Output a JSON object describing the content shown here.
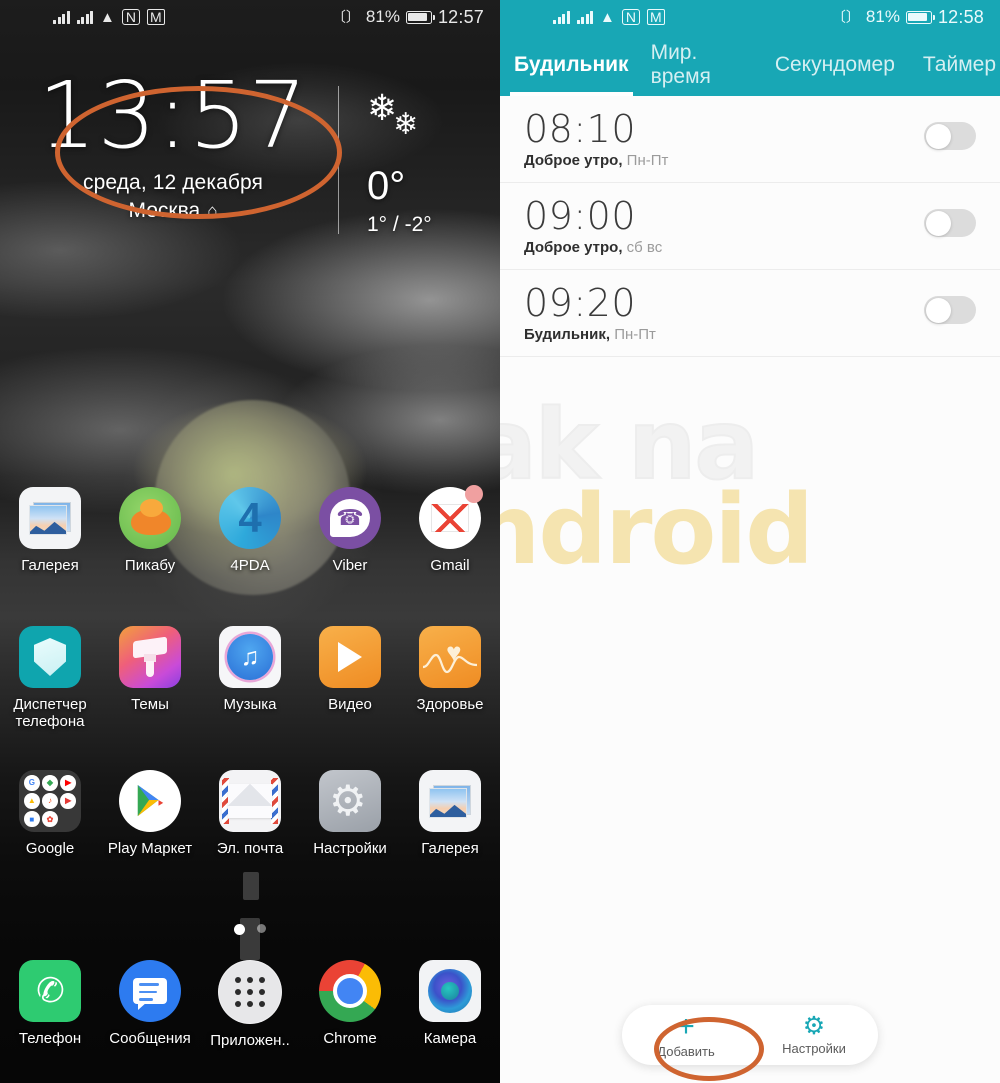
{
  "left_phone": {
    "status_bar": {
      "signal_1": "signal-bars-icon",
      "signal_2": "signal-bars-icon",
      "wifi": "wifi-icon",
      "nfc": "nfc-icon",
      "gmail": "gmail-notification-icon",
      "vibrate": "vibrate-icon",
      "battery_percent": "81%",
      "battery": "battery-icon",
      "time": "12:57"
    },
    "clock_widget": {
      "time": "13:57",
      "date": "среда, 12 декабря",
      "city": "Москва",
      "home_icon": "home-icon",
      "weather_icon": "snowflake-icon",
      "temp": "0°",
      "temp_range": "1° / -2°"
    },
    "apps": [
      [
        {
          "label": "Галерея",
          "icon": "gallery-icon"
        },
        {
          "label": "Пикабу",
          "icon": "pikabu-icon"
        },
        {
          "label": "4PDA",
          "icon": "4pda-icon"
        },
        {
          "label": "Viber",
          "icon": "viber-icon"
        },
        {
          "label": "Gmail",
          "icon": "gmail-icon"
        }
      ],
      [
        {
          "label": "Диспетчер\nтелефона",
          "icon": "phone-manager-icon"
        },
        {
          "label": "Темы",
          "icon": "themes-icon"
        },
        {
          "label": "Музыка",
          "icon": "music-icon"
        },
        {
          "label": "Видео",
          "icon": "video-icon"
        },
        {
          "label": "Здоровье",
          "icon": "health-icon"
        }
      ],
      [
        {
          "label": "Google",
          "icon": "google-folder-icon"
        },
        {
          "label": "Play Маркет",
          "icon": "play-store-icon"
        },
        {
          "label": "Эл. почта",
          "icon": "email-icon"
        },
        {
          "label": "Настройки",
          "icon": "settings-gear-icon"
        },
        {
          "label": "Галерея",
          "icon": "gallery-icon"
        }
      ],
      [
        {
          "label": "Телефон",
          "icon": "phone-dialer-icon"
        },
        {
          "label": "Сообщения",
          "icon": "messages-icon"
        },
        {
          "label": "Приложен..",
          "icon": "app-drawer-icon"
        },
        {
          "label": "Chrome",
          "icon": "chrome-icon"
        },
        {
          "label": "Камера",
          "icon": "camera-icon"
        }
      ]
    ],
    "google_folder_apps": [
      "G",
      "M",
      "▶",
      "△",
      "♪",
      "▶",
      "■",
      "✿"
    ],
    "page_indicator": {
      "total": 3,
      "active": 1
    }
  },
  "right_phone": {
    "status_bar": {
      "battery_percent": "81%",
      "time": "12:58"
    },
    "tabs": [
      {
        "label": "Будильник",
        "active": true
      },
      {
        "label": "Мир. время",
        "active": false
      },
      {
        "label": "Секундомер",
        "active": false
      },
      {
        "label": "Таймер",
        "active": false
      }
    ],
    "alarms": [
      {
        "time": "08:10",
        "name": "Доброе утро,",
        "days": "Пн-Пт",
        "enabled": false
      },
      {
        "time": "09:00",
        "name": "Доброе утро,",
        "days": "сб вс",
        "enabled": false
      },
      {
        "time": "09:20",
        "name": "Будильник,",
        "days": "Пн-Пт",
        "enabled": false
      }
    ],
    "bottom_bar": [
      {
        "label": "Добавить",
        "icon": "plus-icon"
      },
      {
        "label": "Настройки",
        "icon": "gear-icon"
      }
    ],
    "watermark": {
      "line1": "ak na",
      "line2": "ndroid"
    }
  },
  "annotation": {
    "accent_color": "#cf6430",
    "teal_color": "#18a7b5"
  }
}
